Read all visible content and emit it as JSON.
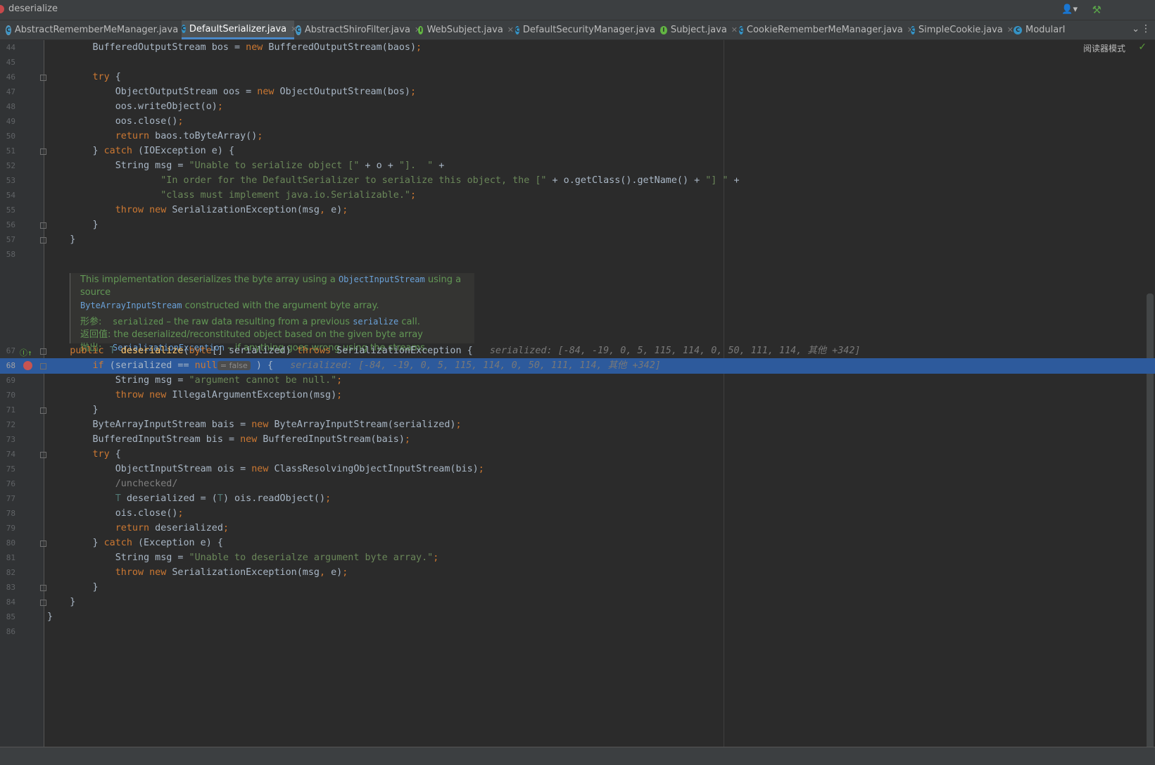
{
  "title": "deserialize",
  "tabs": [
    {
      "label": "AbstractRememberMeManager.java",
      "kind": "a"
    },
    {
      "label": "DefaultSerializer.java",
      "kind": "c",
      "active": true
    },
    {
      "label": "AbstractShiroFilter.java",
      "kind": "a"
    },
    {
      "label": "WebSubject.java",
      "kind": "i"
    },
    {
      "label": "DefaultSecurityManager.java",
      "kind": "c"
    },
    {
      "label": "Subject.java",
      "kind": "i"
    },
    {
      "label": "CookieRememberMeManager.java",
      "kind": "c"
    },
    {
      "label": "SimpleCookie.java",
      "kind": "c"
    },
    {
      "label": "ModularI",
      "kind": "c"
    }
  ],
  "reader_mode": "阅读器模式",
  "doc": {
    "line1a": "This implementation deserializes the byte array using a ",
    "line1b": "ObjectInputStream",
    "line1c": " using a source",
    "line2a": "ByteArrayInputStream",
    "line2b": " constructed with the argument byte array.",
    "param_label": "形参:",
    "param_name": "serialized",
    "param_text": " – the raw data resulting from a previous ",
    "param_link": "serialize",
    "param_end": " call.",
    "return_label": "返回值:",
    "return_text": "the deserialized/reconstituted object based on the given byte array",
    "throws_label": "抛出:",
    "throws_name": "SerializationException",
    "throws_text": " – if anything goes wrong using the streams."
  },
  "lines": [
    {
      "n": "44",
      "html": "        BufferedOutputStream bos = <span class='kw'>new</span> BufferedOutputStream(baos)<span class='kw'>;</span>"
    },
    {
      "n": "45",
      "html": ""
    },
    {
      "n": "46",
      "html": "        <span class='kw'>try</span> {"
    },
    {
      "n": "47",
      "html": "            ObjectOutputStream oos = <span class='kw'>new</span> ObjectOutputStream(bos)<span class='kw'>;</span>"
    },
    {
      "n": "48",
      "html": "            oos.writeObject(o)<span class='kw'>;</span>"
    },
    {
      "n": "49",
      "html": "            oos.close()<span class='kw'>;</span>"
    },
    {
      "n": "50",
      "html": "            <span class='kw'>return</span> baos.toByteArray()<span class='kw'>;</span>"
    },
    {
      "n": "51",
      "html": "        } <span class='kw'>catch</span> (IOException e) {"
    },
    {
      "n": "52",
      "html": "            String msg = <span class='str'>\"Unable to serialize object [\"</span> + o + <span class='str'>\"].  \"</span> +"
    },
    {
      "n": "53",
      "html": "                    <span class='str'>\"In order for the DefaultSerializer to serialize this object, the [\"</span> + o.getClass().getName() + <span class='str'>\"] \"</span> +"
    },
    {
      "n": "54",
      "html": "                    <span class='str'>\"class must implement java.io.Serializable.\"</span><span class='kw'>;</span>"
    },
    {
      "n": "55",
      "html": "            <span class='kw'>throw new</span> SerializationException(msg<span class='kw'>,</span> e)<span class='kw'>;</span>"
    },
    {
      "n": "56",
      "html": "        }"
    },
    {
      "n": "57",
      "html": "    }"
    },
    {
      "n": "58",
      "html": ""
    },
    {
      "n": "67",
      "html": "    <span class='kw'>public</span> <span class='typ'>T</span> <span class='fn'>deserialize</span>(<span class='kw'>byte</span>[] serialized) <span class='kw'>throws</span> SerializationException {   <span class='hint'>serialized: [-84, -19, 0, 5, 115, 114, 0, 50, 111, 114, 其他 +342]</span>"
    },
    {
      "n": "68",
      "html": "        <span class='kw'>if</span> (serialized == <span class='kw'>null</span><span class='inlay'>= false</span> ) {   <span class='hint'>serialized: [-84, -19, 0, 5, 115, 114, 0, 50, 111, 114, 其他 +342]</span>"
    },
    {
      "n": "69",
      "html": "            String msg = <span class='str'>\"argument cannot be null.\"</span><span class='kw'>;</span>"
    },
    {
      "n": "70",
      "html": "            <span class='kw'>throw new</span> IllegalArgumentException(msg)<span class='kw'>;</span>"
    },
    {
      "n": "71",
      "html": "        }"
    },
    {
      "n": "72",
      "html": "        ByteArrayInputStream bais = <span class='kw'>new</span> ByteArrayInputStream(serialized)<span class='kw'>;</span>"
    },
    {
      "n": "73",
      "html": "        BufferedInputStream bis = <span class='kw'>new</span> BufferedInputStream(bais)<span class='kw'>;</span>"
    },
    {
      "n": "74",
      "html": "        <span class='kw'>try</span> {"
    },
    {
      "n": "75",
      "html": "            ObjectInputStream ois = <span class='kw'>new</span> ClassResolvingObjectInputStream(bis)<span class='kw'>;</span>"
    },
    {
      "n": "76",
      "html": "            <span class='cmt'>/unchecked/</span>"
    },
    {
      "n": "77",
      "html": "            <span class='typ'>T</span> deserialized = (<span class='typ'>T</span>) ois.readObject()<span class='kw'>;</span>"
    },
    {
      "n": "78",
      "html": "            ois.close()<span class='kw'>;</span>"
    },
    {
      "n": "79",
      "html": "            <span class='kw'>return</span> deserialized<span class='kw'>;</span>"
    },
    {
      "n": "80",
      "html": "        } <span class='kw'>catch</span> (Exception e) {"
    },
    {
      "n": "81",
      "html": "            String msg = <span class='str'>\"Unable to deserialze argument byte array.\"</span><span class='kw'>;</span>"
    },
    {
      "n": "82",
      "html": "            <span class='kw'>throw new</span> SerializationException(msg<span class='kw'>,</span> e)<span class='kw'>;</span>"
    },
    {
      "n": "83",
      "html": "        }"
    },
    {
      "n": "84",
      "html": "    }"
    },
    {
      "n": "85",
      "html": "}"
    },
    {
      "n": "86",
      "html": ""
    }
  ],
  "highlight_line": "68",
  "breakpoint_line": "68",
  "override_line": "67"
}
